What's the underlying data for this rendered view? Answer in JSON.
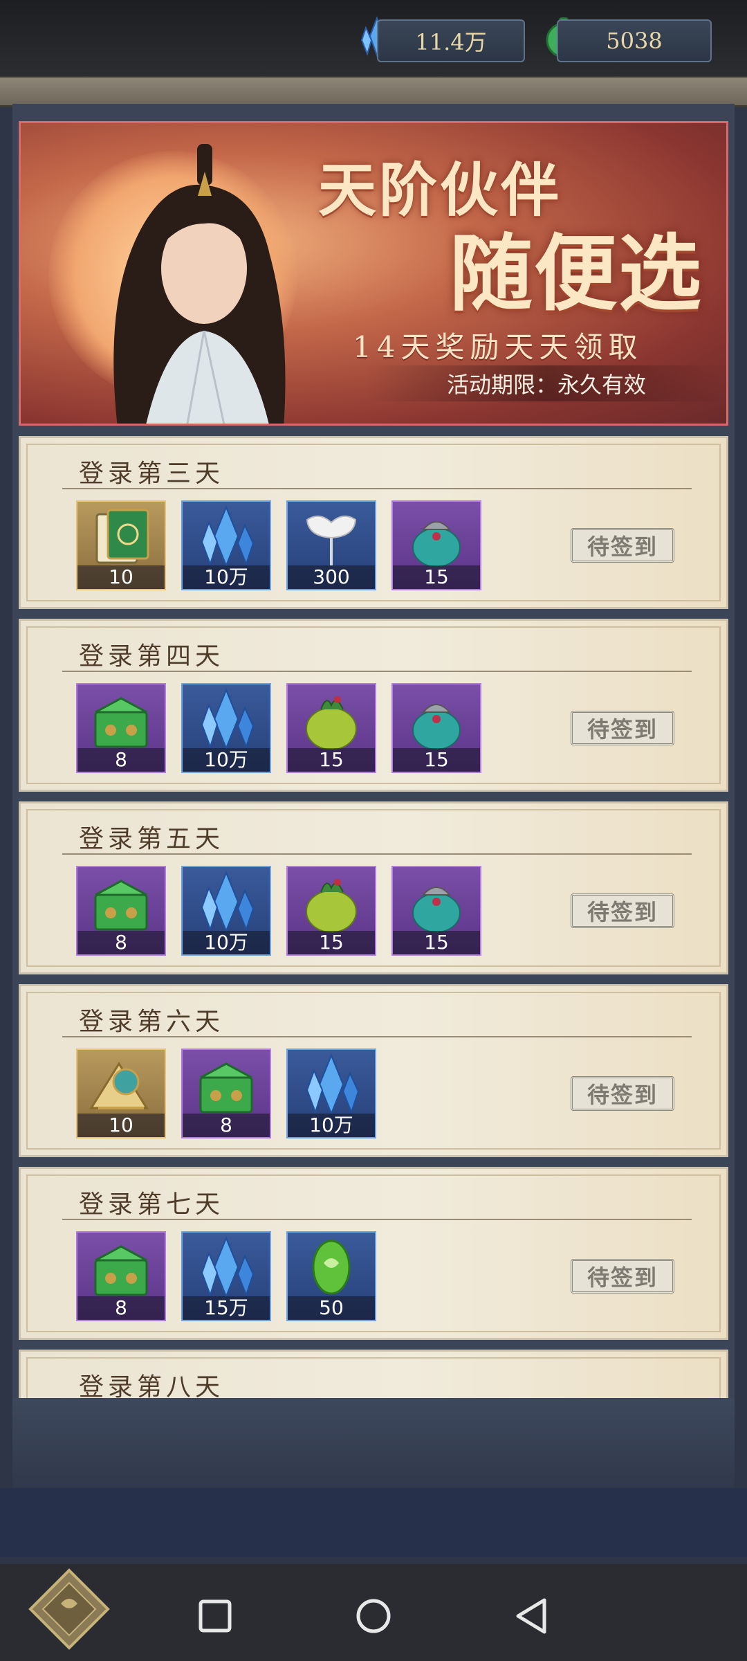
{
  "currencies": {
    "crystal": {
      "icon": "blue-crystal-icon",
      "value": "11.4万"
    },
    "jade": {
      "icon": "jade-coin-icon",
      "value": "5038"
    }
  },
  "banner": {
    "title_line1": "天阶伙伴",
    "title_line2": "随便选",
    "subtitle": "14天奖励天天领取",
    "period": "活动期限：永久有效"
  },
  "days": [
    {
      "title": "登录第三天",
      "button": "待签到",
      "rewards": [
        {
          "icon": "jade-book-icon",
          "frame": "gold",
          "qty": "10"
        },
        {
          "icon": "blue-crystal-icon",
          "frame": "blue",
          "qty": "10万"
        },
        {
          "icon": "ginkgo-leaf-icon",
          "frame": "blue",
          "qty": "300"
        },
        {
          "icon": "teal-pouch-icon",
          "frame": "purple",
          "qty": "15"
        }
      ]
    },
    {
      "title": "登录第四天",
      "button": "待签到",
      "rewards": [
        {
          "icon": "green-chest-icon",
          "frame": "purple",
          "qty": "8"
        },
        {
          "icon": "blue-crystal-icon",
          "frame": "blue",
          "qty": "10万"
        },
        {
          "icon": "green-herb-pouch-icon",
          "frame": "purple",
          "qty": "15"
        },
        {
          "icon": "teal-pouch-icon",
          "frame": "purple",
          "qty": "15"
        }
      ]
    },
    {
      "title": "登录第五天",
      "button": "待签到",
      "rewards": [
        {
          "icon": "green-chest-icon",
          "frame": "purple",
          "qty": "8"
        },
        {
          "icon": "blue-crystal-icon",
          "frame": "blue",
          "qty": "10万"
        },
        {
          "icon": "green-herb-pouch-icon",
          "frame": "purple",
          "qty": "15"
        },
        {
          "icon": "teal-pouch-icon",
          "frame": "purple",
          "qty": "15"
        }
      ]
    },
    {
      "title": "登录第六天",
      "button": "待签到",
      "rewards": [
        {
          "icon": "golden-scroll-icon",
          "frame": "gold",
          "qty": "10"
        },
        {
          "icon": "green-chest-icon",
          "frame": "purple",
          "qty": "8"
        },
        {
          "icon": "blue-crystal-icon",
          "frame": "blue",
          "qty": "10万"
        }
      ]
    },
    {
      "title": "登录第七天",
      "button": "待签到",
      "rewards": [
        {
          "icon": "green-chest-icon",
          "frame": "purple",
          "qty": "8"
        },
        {
          "icon": "blue-crystal-icon",
          "frame": "blue",
          "qty": "15万"
        },
        {
          "icon": "green-jade-egg-icon",
          "frame": "blue",
          "qty": "50"
        }
      ]
    },
    {
      "title": "登录第八天",
      "button": "",
      "rewards": []
    }
  ],
  "nav": {
    "recent_icon": "square-recent-apps-icon",
    "home_icon": "circle-home-icon",
    "back_icon": "triangle-back-icon"
  }
}
